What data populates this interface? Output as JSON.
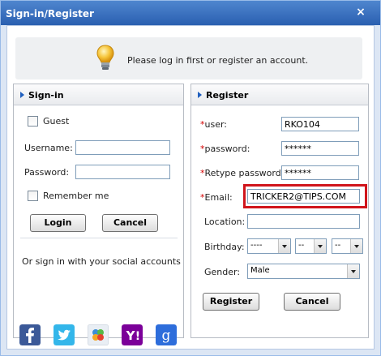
{
  "window": {
    "title": "Sign-in/Register",
    "close_glyph": "×"
  },
  "banner": {
    "text": "Please log in first or register an account.",
    "icon": "lightbulb-icon"
  },
  "signin": {
    "header": "Sign-in",
    "guest_label": "Guest",
    "username_label": "Username:",
    "username_value": "",
    "password_label": "Password:",
    "password_value": "",
    "remember_label": "Remember me",
    "login_button": "Login",
    "cancel_button": "Cancel",
    "social_text": "Or sign in with your social accounts",
    "social_icons": [
      "facebook-icon",
      "twitter-icon",
      "windows-live-icon",
      "yahoo-icon",
      "google-icon"
    ]
  },
  "register": {
    "header": "Register",
    "star": "*",
    "user_label": "user:",
    "user_value": "RKO104",
    "password_label": "password:",
    "password_value": "******",
    "retype_label": "Retype password:",
    "retype_value": "******",
    "email_label": "Email:",
    "email_value": "TRICKER2@TIPS.COM",
    "location_label": "Location:",
    "location_value": "",
    "birthday_label": "Birthday:",
    "birthday_year": "----",
    "birthday_month": "--",
    "birthday_day": "--",
    "gender_label": "Gender:",
    "gender_value": "Male",
    "register_button": "Register",
    "cancel_button": "Cancel"
  },
  "colors": {
    "title_bar": "#2a5fb0",
    "required_star": "#d40000",
    "highlight_box": "#d0141b",
    "facebook": "#3b5998",
    "twitter": "#33b6ea",
    "yahoo": "#7b0099",
    "google": "#2d6ddb"
  }
}
